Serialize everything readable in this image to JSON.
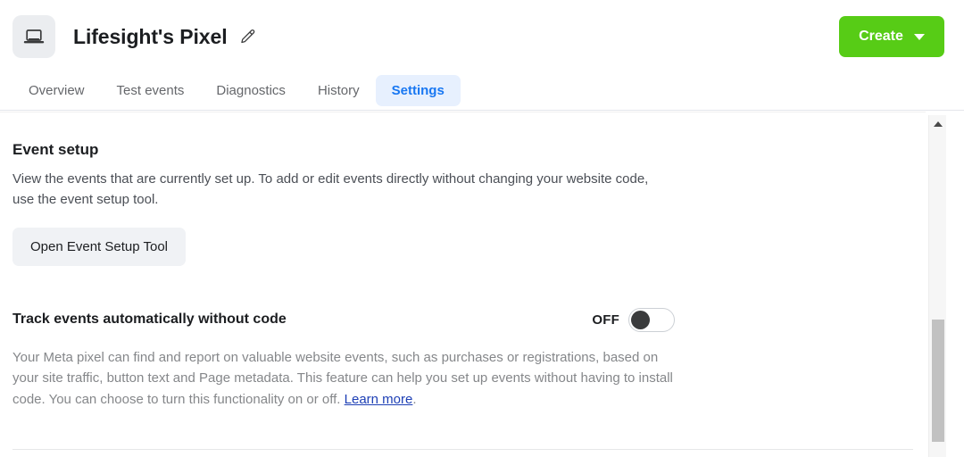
{
  "header": {
    "pixel_icon": "laptop-icon",
    "title": "Lifesight's Pixel",
    "edit_icon": "pencil-icon",
    "create_button": {
      "label": "Create",
      "icon": "chevron-down-icon",
      "color": "#57cc16"
    }
  },
  "tabs": [
    {
      "label": "Overview",
      "active": false
    },
    {
      "label": "Test events",
      "active": false
    },
    {
      "label": "Diagnostics",
      "active": false
    },
    {
      "label": "History",
      "active": false
    },
    {
      "label": "Settings",
      "active": true
    }
  ],
  "event_setup": {
    "title": "Event setup",
    "description": "View the events that are currently set up. To add or edit events directly without changing your website code, use the event setup tool.",
    "button_label": "Open Event Setup Tool"
  },
  "track_events": {
    "title": "Track events automatically without code",
    "toggle_state": "OFF",
    "toggle_on": false,
    "description": "Your Meta pixel can find and report on valuable website events, such as purchases or registrations, based on your site traffic, button text and Page metadata. This feature can help you set up events without having to install code. You can choose to turn this functionality on or off. ",
    "learn_more_label": "Learn more",
    "description_suffix": "."
  },
  "colors": {
    "accent_blue": "#1877f2",
    "active_tab_bg": "#e7f0fe",
    "create_green": "#57cc16",
    "link_blue": "#1d3fb5"
  },
  "scrollbar": {
    "up_arrow_icon": "scroll-up-arrow-icon",
    "thumb": "scroll-thumb"
  }
}
